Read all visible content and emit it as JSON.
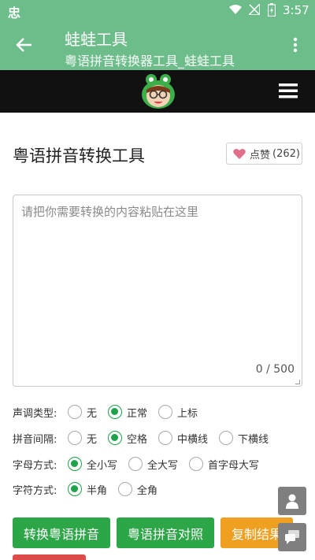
{
  "status_bar": {
    "app_glyph": "忠",
    "time": "3:57",
    "icons": [
      "wifi-icon",
      "no-signal-icon",
      "battery-charging-icon"
    ]
  },
  "action_bar": {
    "title": "蛙蛙工具",
    "subtitle": "粤语拼音转换器工具_蛙蛙工具",
    "icons": [
      "back-arrow-icon",
      "more-vert-icon"
    ],
    "color": "#6dbd8a"
  },
  "site_header": {
    "icons": [
      "frog-logo-icon",
      "hamburger-menu-icon"
    ],
    "color": "#111111"
  },
  "page": {
    "title": "粤语拼音转换工具",
    "like_label": "点赞",
    "like_count": "(262)"
  },
  "input": {
    "placeholder": "请把你需要转换的内容粘贴在这里",
    "value": "",
    "counter": "0 / 500"
  },
  "options": {
    "tone": {
      "label": "声调类型:",
      "items": [
        "无",
        "正常",
        "上标"
      ],
      "selected": "正常"
    },
    "spacing": {
      "label": "拼音间隔:",
      "items": [
        "无",
        "空格",
        "中横线",
        "下横线"
      ],
      "selected": "空格"
    },
    "letter_case": {
      "label": "字母方式:",
      "items": [
        "全小写",
        "全大写",
        "首字母大写"
      ],
      "selected": "全小写"
    },
    "char_width": {
      "label": "字符方式:",
      "items": [
        "半角",
        "全角"
      ],
      "selected": "半角"
    }
  },
  "buttons": {
    "convert": "转换粤语拼音",
    "compare": "粤语拼音对照",
    "copy": "复制结果"
  },
  "colors": {
    "primary_green": "#2da648",
    "orange": "#f0a020",
    "red": "#de4b4b",
    "heart": "#e0708a"
  },
  "floating": [
    "user-icon",
    "chat-icon"
  ]
}
